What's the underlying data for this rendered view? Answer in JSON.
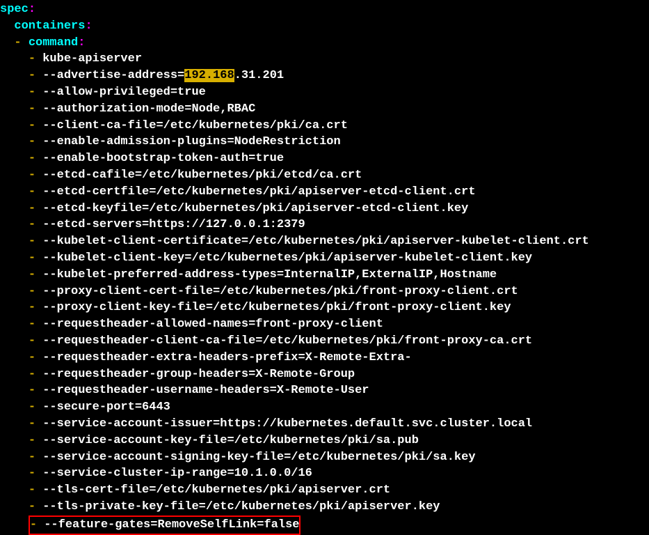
{
  "colors": {
    "key": "#00ffff",
    "colon": "#ff00ff",
    "dash": "#d7af00",
    "text": "#ffffff",
    "highlight_bg": "#d7af00",
    "highlight_fg": "#000000",
    "box_border": "#ff0000",
    "background": "#000000"
  },
  "yaml": {
    "spec_key": "spec",
    "containers_key": "containers",
    "command_key": "command",
    "indent_spec": "",
    "indent_containers": "  ",
    "indent_command_dash": "  ",
    "indent_command": "    ",
    "indent_item_dash": "    ",
    "indent_item": "      ",
    "highlight_text": "192.168",
    "advertise_prefix": "--advertise-address=",
    "advertise_suffix": ".31.201",
    "items": [
      "kube-apiserver",
      "ADVERTISE_PLACEHOLDER",
      "--allow-privileged=true",
      "--authorization-mode=Node,RBAC",
      "--client-ca-file=/etc/kubernetes/pki/ca.crt",
      "--enable-admission-plugins=NodeRestriction",
      "--enable-bootstrap-token-auth=true",
      "--etcd-cafile=/etc/kubernetes/pki/etcd/ca.crt",
      "--etcd-certfile=/etc/kubernetes/pki/apiserver-etcd-client.crt",
      "--etcd-keyfile=/etc/kubernetes/pki/apiserver-etcd-client.key",
      "--etcd-servers=https://127.0.0.1:2379",
      "--kubelet-client-certificate=/etc/kubernetes/pki/apiserver-kubelet-client.crt",
      "--kubelet-client-key=/etc/kubernetes/pki/apiserver-kubelet-client.key",
      "--kubelet-preferred-address-types=InternalIP,ExternalIP,Hostname",
      "--proxy-client-cert-file=/etc/kubernetes/pki/front-proxy-client.crt",
      "--proxy-client-key-file=/etc/kubernetes/pki/front-proxy-client.key",
      "--requestheader-allowed-names=front-proxy-client",
      "--requestheader-client-ca-file=/etc/kubernetes/pki/front-proxy-ca.crt",
      "--requestheader-extra-headers-prefix=X-Remote-Extra-",
      "--requestheader-group-headers=X-Remote-Group",
      "--requestheader-username-headers=X-Remote-User",
      "--secure-port=6443",
      "--service-account-issuer=https://kubernetes.default.svc.cluster.local",
      "--service-account-key-file=/etc/kubernetes/pki/sa.pub",
      "--service-account-signing-key-file=/etc/kubernetes/pki/sa.key",
      "--service-cluster-ip-range=10.1.0.0/16",
      "--tls-cert-file=/etc/kubernetes/pki/apiserver.crt",
      "--tls-private-key-file=/etc/kubernetes/pki/apiserver.key"
    ],
    "boxed_item": "--feature-gates=RemoveSelfLink=false"
  }
}
